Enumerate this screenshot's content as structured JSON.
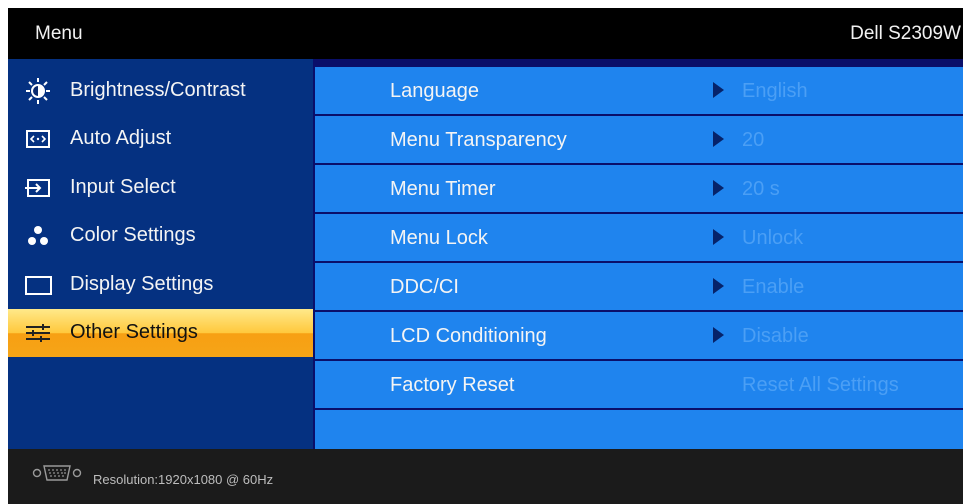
{
  "header": {
    "title": "Menu",
    "model": "Dell S2309W"
  },
  "sidebar": {
    "items": [
      {
        "label": "Brightness/Contrast",
        "icon": "brightness-icon"
      },
      {
        "label": "Auto Adjust",
        "icon": "auto-adjust-icon"
      },
      {
        "label": "Input Select",
        "icon": "input-select-icon"
      },
      {
        "label": "Color Settings",
        "icon": "color-settings-icon"
      },
      {
        "label": "Display Settings",
        "icon": "display-settings-icon"
      },
      {
        "label": "Other Settings",
        "icon": "sliders-icon",
        "selected": true
      }
    ]
  },
  "settings": {
    "rows": [
      {
        "name": "Language",
        "value": "English"
      },
      {
        "name": "Menu Transparency",
        "value": "20"
      },
      {
        "name": "Menu Timer",
        "value": "20 s"
      },
      {
        "name": "Menu Lock",
        "value": "Unlock"
      },
      {
        "name": "DDC/CI",
        "value": "Enable"
      },
      {
        "name": "LCD Conditioning",
        "value": "Disable"
      },
      {
        "name": "Factory Reset",
        "value": "Reset All Settings"
      }
    ]
  },
  "footer": {
    "resolution": "Resolution:1920x1080 @ 60Hz",
    "icon": "vga-port-icon"
  },
  "colors": {
    "sidebar_bg": "#053181",
    "row_bg": "#1f84ee",
    "row_value": "#4b9ff5",
    "active_top": "#ffe98a",
    "active_bottom": "#f79f13",
    "footer_bg": "#1b1b1b"
  }
}
